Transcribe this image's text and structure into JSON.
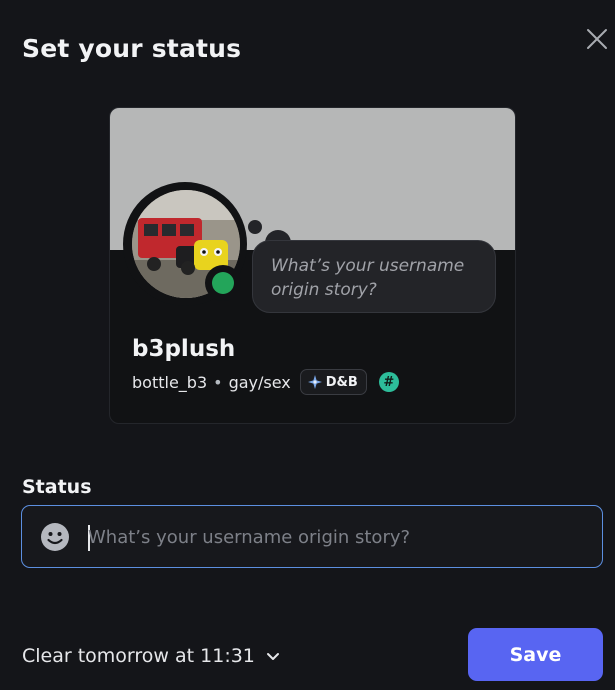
{
  "dialog": {
    "title": "Set your status"
  },
  "profile": {
    "display_name": "b3plush",
    "username": "bottle_b3",
    "separator": "•",
    "pronouns": "gay/sex",
    "tag_label": "D&B",
    "hash_badge": "#",
    "thought_bubble": "What’s your username origin story?",
    "status_indicator": "online",
    "colors": {
      "banner": "#b6b7b7",
      "online": "#23a55a",
      "hash_badge": "#2dbd9a"
    }
  },
  "status_field": {
    "label": "Status",
    "value": "",
    "placeholder": "What’s your username origin story?",
    "emoji_icon": "smiley-face-icon"
  },
  "footer": {
    "clear_after": "Clear tomorrow at 11:31",
    "save_label": "Save",
    "accent": "#5865f2"
  }
}
